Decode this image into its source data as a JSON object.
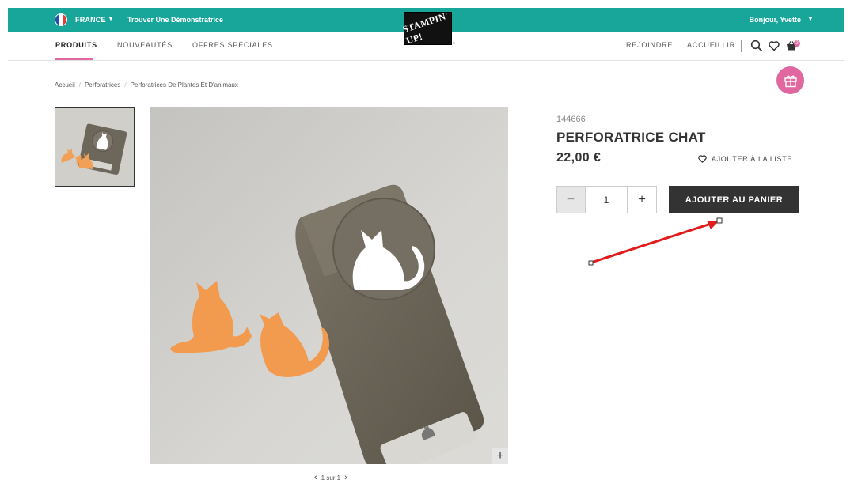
{
  "topbar": {
    "country": "FRANCE",
    "find_demonstrator": "Trouver Une Démonstratrice",
    "greeting": "Bonjour, Yvette"
  },
  "logo": {
    "text": "STAMPIN' UP!",
    "reg": "®"
  },
  "nav": {
    "products": "PRODUITS",
    "new": "NOUVEAUTÉS",
    "offers": "OFFRES SPÉCIALES",
    "join": "REJOINDRE",
    "host": "ACCUEILLIR",
    "cart_count": "2"
  },
  "breadcrumb": {
    "items": [
      "Accueil",
      "Perforatrices",
      "Perforatrices De Plantes Et D'animaux"
    ]
  },
  "product": {
    "sku": "144666",
    "title": "PERFORATRICE CHAT",
    "price": "22,00 €",
    "wishlist_label": "AJOUTER À LA LISTE",
    "quantity": "1",
    "minus_label": "−",
    "plus_label": "+",
    "add_to_cart_label": "AJOUTER AU PANIER"
  },
  "gallery": {
    "pager_text": "1 sur 1",
    "zoom_label": "+"
  },
  "colors": {
    "topbar": "#18a69a",
    "accent_pink": "#e0679f",
    "button_dark": "#333333",
    "annotation_arrow": "#e11b1b"
  }
}
